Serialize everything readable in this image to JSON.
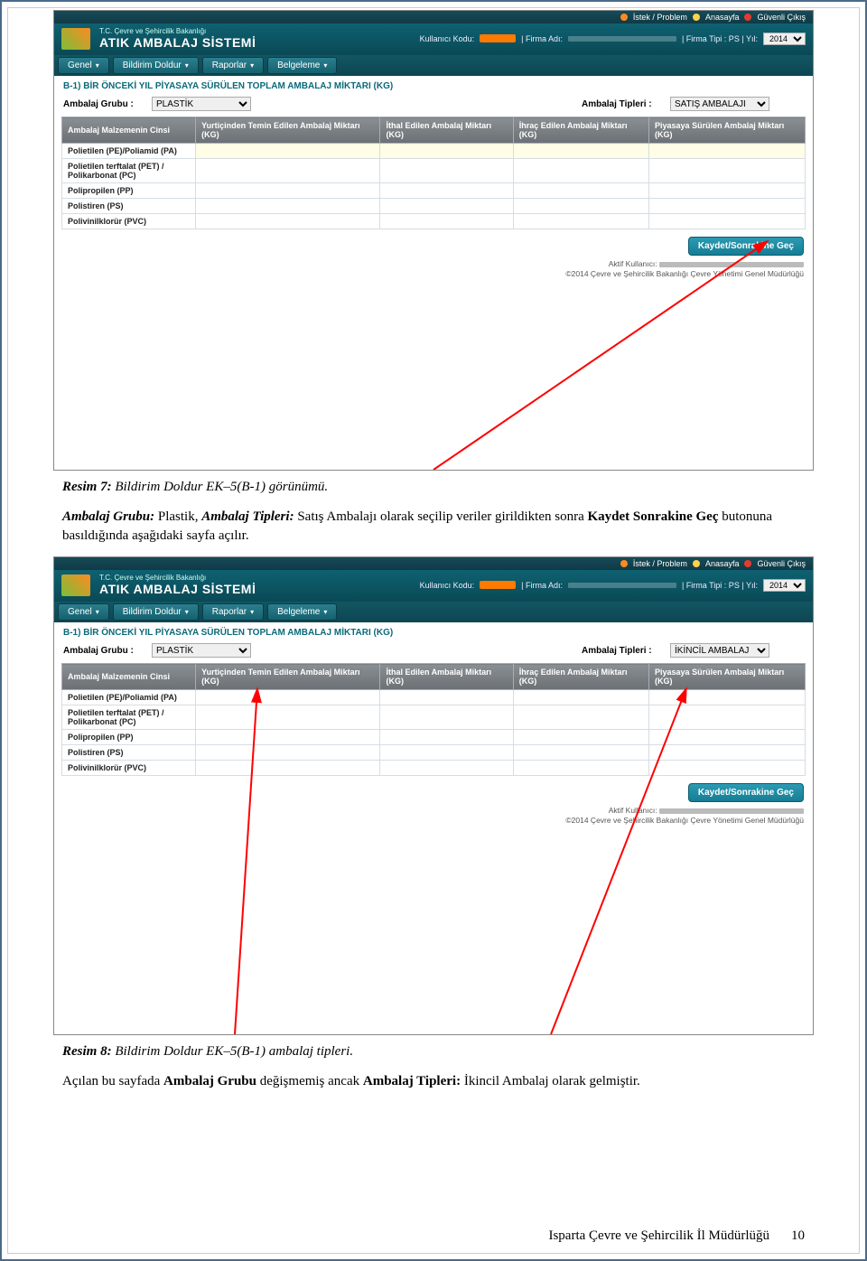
{
  "topbar": {
    "istek": "İstek / Problem",
    "anasayfa": "Anasayfa",
    "guvenli": "Güvenli Çıkış"
  },
  "brand": {
    "sub": "T.C. Çevre ve Şehircilik Bakanlığı",
    "title": "ATIK AMBALAJ SİSTEMİ"
  },
  "userinfo": {
    "kullanici_label": "Kullanıcı Kodu:",
    "firma_label": "| Firma Adı:",
    "firma_tipi": "| Firma Tipi : PS | Yıl:",
    "year": "2014"
  },
  "menu": {
    "genel": "Genel",
    "bildirim": "Bildirim Doldur",
    "raporlar": "Raporlar",
    "belgeleme": "Belgeleme"
  },
  "section_title": "B-1) BİR ÖNCEKİ YIL PİYASAYA SÜRÜLEN TOPLAM AMBALAJ MİKTARI (KG)",
  "filters": {
    "grubu_label": "Ambalaj Grubu :",
    "grubu_value": "PLASTİK",
    "tipleri_label": "Ambalaj Tipleri :",
    "tipleri_value_1": "SATIŞ AMBALAJI",
    "tipleri_value_2": "İKİNCİL AMBALAJ"
  },
  "columns": {
    "c0": "Ambalaj Malzemenin Cinsi",
    "c1": "Yurtiçinden Temin Edilen Ambalaj Miktarı (KG)",
    "c2": "İthal Edilen Ambalaj Miktarı (KG)",
    "c3": "İhraç Edilen Ambalaj Miktarı (KG)",
    "c4": "Piyasaya Sürülen Ambalaj Miktarı (KG)"
  },
  "rows": {
    "r0": "Polietilen (PE)/Poliamid (PA)",
    "r1": "Polietilen terftalat (PET) / Polikarbonat (PC)",
    "r2": "Polipropilen (PP)",
    "r3": "Polistiren (PS)",
    "r4": "Polivinilklorür (PVC)"
  },
  "save_button": "Kaydet/Sonrakine Geç",
  "footer": {
    "aktif": "Aktif Kullanıcı:",
    "copyright": "©2014 Çevre ve Şehircilik Bakanlığı Çevre Yönetimi Genel Müdürlüğü"
  },
  "captions": {
    "resim7_label": "Resim 7:",
    "resim7_text": " Bildirim Doldur EK–5(B-1) görünümü.",
    "para1_a": "Ambalaj Grubu:",
    "para1_b": " Plastik, ",
    "para1_c": "Ambalaj Tipleri:",
    "para1_d": " Satış Ambalajı olarak seçilip veriler girildikten sonra ",
    "para1_e": "Kaydet Sonrakine Geç",
    "para1_f": " butonuna basıldığında aşağıdaki sayfa açılır.",
    "resim8_label": "Resim 8:",
    "resim8_text": " Bildirim Doldur EK–5(B-1) ambalaj tipleri.",
    "para2_a": "Açılan bu sayfada ",
    "para2_b": "Ambalaj Grubu",
    "para2_c": " değişmemiş ancak ",
    "para2_d": "Ambalaj Tipleri:",
    "para2_e": " İkincil Ambalaj olarak gelmiştir."
  },
  "page_footer": {
    "org": "Isparta Çevre ve Şehircilik İl Müdürlüğü",
    "num": "10"
  }
}
